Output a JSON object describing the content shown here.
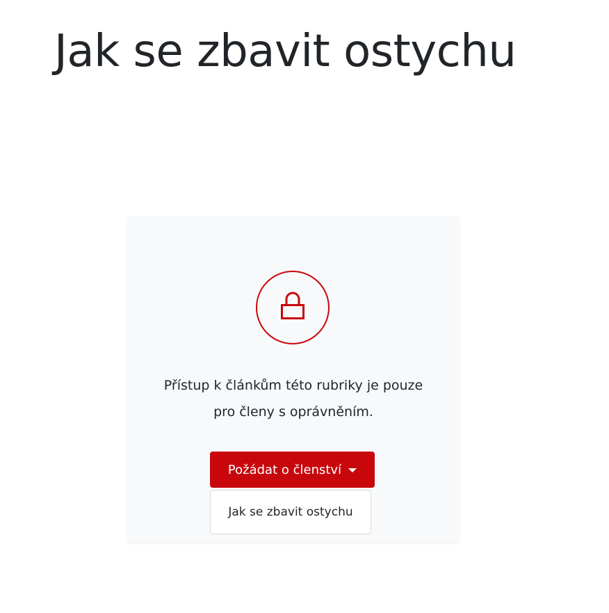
{
  "page": {
    "title": "Jak se zbavit ostychu"
  },
  "lock_card": {
    "icon": "lock-icon",
    "message": "Přístup k článkům této rubriky je pouze pro členy s oprávněním.",
    "membership_button_label": "Požádat o členství",
    "dropdown_items": [
      {
        "label": "Jak se zbavit ostychu"
      }
    ]
  },
  "colors": {
    "accent": "#c8070c",
    "card_background": "#f8f9fa",
    "text": "#212529"
  }
}
